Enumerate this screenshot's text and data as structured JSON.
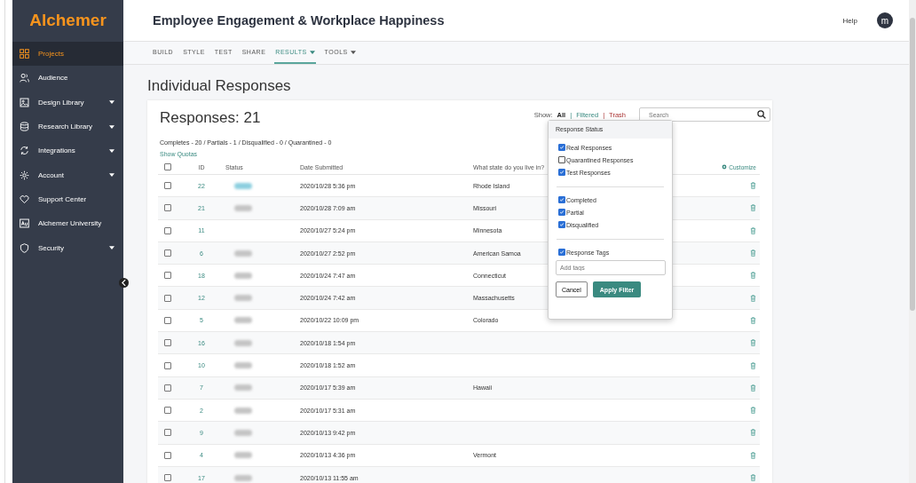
{
  "brand": "Alchemer",
  "sidebar": {
    "items": [
      {
        "label": "Projects",
        "selected": true,
        "expandable": false
      },
      {
        "label": "Audience",
        "selected": false,
        "expandable": false
      },
      {
        "label": "Design Library",
        "selected": false,
        "expandable": true
      },
      {
        "label": "Research Library",
        "selected": false,
        "expandable": true
      },
      {
        "label": "Integrations",
        "selected": false,
        "expandable": true
      },
      {
        "label": "Account",
        "selected": false,
        "expandable": true
      },
      {
        "label": "Support Center",
        "selected": false,
        "expandable": false
      },
      {
        "label": "Alchemer University",
        "selected": false,
        "expandable": false
      },
      {
        "label": "Security",
        "selected": false,
        "expandable": true
      }
    ]
  },
  "header": {
    "title": "Employee Engagement & Workplace Happiness",
    "help": "Help",
    "avatar": "m"
  },
  "nav": [
    {
      "label": "BUILD",
      "selected": false,
      "dropdown": false
    },
    {
      "label": "STYLE",
      "selected": false,
      "dropdown": false
    },
    {
      "label": "TEST",
      "selected": false,
      "dropdown": false
    },
    {
      "label": "SHARE",
      "selected": false,
      "dropdown": false
    },
    {
      "label": "RESULTS",
      "selected": true,
      "dropdown": true
    },
    {
      "label": "TOOLS",
      "selected": false,
      "dropdown": true
    }
  ],
  "page_title": "Individual Responses",
  "responses_title": "Responses: 21",
  "summary": "Completes - 20 / Partials - 1 / Disqualified - 0 / Quarantined - 0",
  "show_quotas": "Show Quotas",
  "show": {
    "label": "Show:",
    "separator": "|",
    "options": [
      {
        "label": "All",
        "selected": true
      },
      {
        "label": "Filtered",
        "selected": false
      },
      {
        "label": "Trash",
        "selected": false
      }
    ]
  },
  "search": {
    "placeholder": "Search"
  },
  "table": {
    "columns": [
      "ID",
      "Status",
      "Date Submitted",
      "What state do you live in?"
    ],
    "customize": "Customize",
    "select_all_checked": false,
    "rows": [
      {
        "checked": false,
        "id": "22",
        "color": "#8ccfdf",
        "date": "2020/10/28 5:36 pm",
        "state": "Rhode Island"
      },
      {
        "checked": false,
        "id": "21",
        "color": "#c4c4c4",
        "date": "2020/10/28 7:09 am",
        "state": "Missouri"
      },
      {
        "checked": false,
        "id": "11",
        "date": "2020/10/27 5:24 pm",
        "state": "Minnesota"
      },
      {
        "checked": false,
        "id": "6",
        "color": "#c4c4c4",
        "date": "2020/10/27 2:52 pm",
        "state": "American Samoa"
      },
      {
        "checked": false,
        "id": "18",
        "color": "#c4c4c4",
        "date": "2020/10/24 7:47 am",
        "state": "Connecticut"
      },
      {
        "checked": false,
        "id": "12",
        "color": "#c4c4c4",
        "date": "2020/10/24 7:42 am",
        "state": "Massachusetts"
      },
      {
        "checked": false,
        "id": "5",
        "color": "#c4c4c4",
        "date": "2020/10/22 10:09 pm",
        "state": "Colorado"
      },
      {
        "checked": false,
        "id": "16",
        "color": "#c4c4c4",
        "date": "2020/10/18 1:54 pm"
      },
      {
        "checked": false,
        "id": "10",
        "color": "#c4c4c4",
        "date": "2020/10/18 1:52 am"
      },
      {
        "checked": false,
        "id": "7",
        "color": "#c4c4c4",
        "date": "2020/10/17 5:39 am",
        "state": "Hawaii"
      },
      {
        "checked": false,
        "id": "2",
        "color": "#c4c4c4",
        "date": "2020/10/17 5:31 am"
      },
      {
        "checked": false,
        "id": "9",
        "color": "#c4c4c4",
        "date": "2020/10/13 9:42 pm"
      },
      {
        "checked": false,
        "id": "4",
        "color": "#c4c4c4",
        "date": "2020/10/13 4:36 pm",
        "state": "Vermont"
      },
      {
        "checked": false,
        "id": "17",
        "color": "#c4c4c4",
        "date": "2020/10/13 11:55 am"
      }
    ]
  },
  "filter": {
    "title": "Response Status",
    "groups": [
      [
        {
          "label": "Real Responses",
          "checked": true
        },
        {
          "label": "Quarantined Responses",
          "checked": false
        },
        {
          "label": "Test Responses",
          "checked": true
        }
      ],
      [
        {
          "label": "Completed",
          "checked": true
        },
        {
          "label": "Partial",
          "checked": true
        },
        {
          "label": "Disqualified",
          "checked": true
        }
      ],
      [
        {
          "label": "Response Tags",
          "checked": true
        }
      ]
    ],
    "tags_placeholder": "Add tags",
    "cancel": "Cancel",
    "apply": "Apply Filter"
  }
}
